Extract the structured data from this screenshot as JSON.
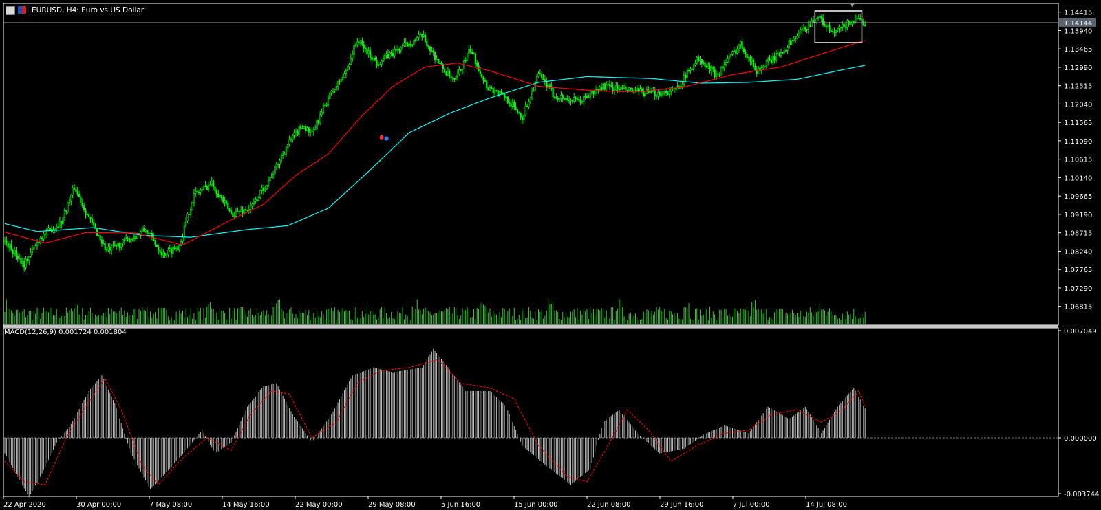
{
  "header": {
    "symbol_title": "EURUSD, H4:  Euro vs US Dollar",
    "macd_label": "MACD(12,26,9) 0.001724 0.001804"
  },
  "colors": {
    "background": "#000000",
    "axis": "#ffffff",
    "candle": "#00ff00",
    "volume": "#32cd32",
    "ma_fast": "#ff0000",
    "ma_slow": "#00ffff",
    "macd_hist": "#c0c0c0",
    "macd_signal": "#ff0000",
    "grid_line": "#a0a0a0"
  },
  "chart_data": [
    {
      "type": "candlestick",
      "title": "EURUSD, H4: Euro vs US Dollar",
      "price_ticks": [
        "1.14415",
        "1.13940",
        "1.13465",
        "1.12990",
        "1.12515",
        "1.12040",
        "1.11565",
        "1.11090",
        "1.10615",
        "1.10140",
        "1.09665",
        "1.09190",
        "1.08715",
        "1.08240",
        "1.07765",
        "1.07290",
        "1.06815"
      ],
      "current_price": "1.14144",
      "ylim": [
        1.0633,
        1.1464
      ],
      "time_labels": [
        "22 Apr 2020",
        "30 Apr 00:00",
        "7 May 08:00",
        "14 May 16:00",
        "22 May 00:00",
        "29 May 08:00",
        "5 Jun 16:00",
        "15 Jun 00:00",
        "22 Jun 08:00",
        "29 Jun 16:00",
        "7 Jul 00:00",
        "14 Jul 08:00"
      ],
      "close_keyframes": [
        [
          0,
          1.085
        ],
        [
          12,
          1.079
        ],
        [
          22,
          1.086
        ],
        [
          35,
          1.09
        ],
        [
          43,
          1.099
        ],
        [
          52,
          1.091
        ],
        [
          63,
          1.0825
        ],
        [
          75,
          1.085
        ],
        [
          87,
          1.088
        ],
        [
          98,
          1.0815
        ],
        [
          108,
          1.084
        ],
        [
          117,
          1.097
        ],
        [
          128,
          1.1
        ],
        [
          140,
          1.092
        ],
        [
          152,
          1.0935
        ],
        [
          165,
          1.102
        ],
        [
          175,
          1.11
        ],
        [
          184,
          1.115
        ],
        [
          190,
          1.1125
        ],
        [
          200,
          1.122
        ],
        [
          210,
          1.128
        ],
        [
          218,
          1.137
        ],
        [
          230,
          1.131
        ],
        [
          245,
          1.135
        ],
        [
          258,
          1.138
        ],
        [
          270,
          1.13
        ],
        [
          278,
          1.126
        ],
        [
          288,
          1.1345
        ],
        [
          298,
          1.125
        ],
        [
          310,
          1.122
        ],
        [
          320,
          1.117
        ],
        [
          330,
          1.128
        ],
        [
          340,
          1.1225
        ],
        [
          355,
          1.121
        ],
        [
          370,
          1.125
        ],
        [
          385,
          1.124
        ],
        [
          400,
          1.123
        ],
        [
          415,
          1.124
        ],
        [
          428,
          1.132
        ],
        [
          440,
          1.128
        ],
        [
          455,
          1.136
        ],
        [
          465,
          1.129
        ],
        [
          478,
          1.133
        ],
        [
          492,
          1.139
        ],
        [
          503,
          1.143
        ],
        [
          512,
          1.1385
        ],
        [
          524,
          1.142
        ],
        [
          533,
          1.1414
        ]
      ],
      "ma_fast_keyframes": [
        [
          0,
          1.0873
        ],
        [
          25,
          1.0845
        ],
        [
          50,
          1.0872
        ],
        [
          80,
          1.0871
        ],
        [
          110,
          1.084
        ],
        [
          140,
          1.0905
        ],
        [
          160,
          1.0945
        ],
        [
          180,
          1.102
        ],
        [
          200,
          1.1075
        ],
        [
          220,
          1.117
        ],
        [
          240,
          1.125
        ],
        [
          260,
          1.13
        ],
        [
          280,
          1.131
        ],
        [
          300,
          1.129
        ],
        [
          330,
          1.125
        ],
        [
          360,
          1.124
        ],
        [
          390,
          1.1235
        ],
        [
          420,
          1.1248
        ],
        [
          450,
          1.128
        ],
        [
          480,
          1.13
        ],
        [
          510,
          1.134
        ],
        [
          533,
          1.137
        ]
      ],
      "ma_slow_keyframes": [
        [
          0,
          1.0895
        ],
        [
          20,
          1.0875
        ],
        [
          55,
          1.0885
        ],
        [
          85,
          1.0865
        ],
        [
          115,
          1.086
        ],
        [
          150,
          1.088
        ],
        [
          175,
          1.089
        ],
        [
          200,
          1.0935
        ],
        [
          225,
          1.103
        ],
        [
          250,
          1.113
        ],
        [
          275,
          1.118
        ],
        [
          300,
          1.122
        ],
        [
          330,
          1.126
        ],
        [
          360,
          1.1275
        ],
        [
          400,
          1.127
        ],
        [
          430,
          1.1258
        ],
        [
          460,
          1.126
        ],
        [
          490,
          1.1268
        ],
        [
          515,
          1.129
        ],
        [
          533,
          1.1305
        ]
      ],
      "bars": 533
    },
    {
      "type": "histogram",
      "title": "MACD(12,26,9) 0.001724 0.001804",
      "y_ticks": [
        "0.007049",
        "0.000000",
        "-0.003744"
      ],
      "ylim": [
        -0.003744,
        0.007049
      ],
      "macd_keyframes": [
        [
          0,
          -0.001
        ],
        [
          15,
          -0.0038
        ],
        [
          22,
          -0.0025
        ],
        [
          32,
          -0.0003
        ],
        [
          40,
          0.0007
        ],
        [
          52,
          0.003
        ],
        [
          60,
          0.004
        ],
        [
          68,
          0.0022
        ],
        [
          78,
          -0.001
        ],
        [
          90,
          -0.0033
        ],
        [
          100,
          -0.0022
        ],
        [
          112,
          -0.0008
        ],
        [
          122,
          0.0005
        ],
        [
          130,
          -0.001
        ],
        [
          140,
          -0.0003
        ],
        [
          150,
          0.002
        ],
        [
          160,
          0.0033
        ],
        [
          168,
          0.0035
        ],
        [
          178,
          0.0015
        ],
        [
          190,
          -0.0003
        ],
        [
          202,
          0.0015
        ],
        [
          215,
          0.004
        ],
        [
          228,
          0.0045
        ],
        [
          240,
          0.0042
        ],
        [
          258,
          0.0045
        ],
        [
          265,
          0.0057
        ],
        [
          272,
          0.0048
        ],
        [
          285,
          0.003
        ],
        [
          300,
          0.003
        ],
        [
          310,
          0.002
        ],
        [
          320,
          -0.0005
        ],
        [
          335,
          -0.0018
        ],
        [
          350,
          -0.003
        ],
        [
          362,
          -0.002
        ],
        [
          370,
          0.001
        ],
        [
          380,
          0.0018
        ],
        [
          392,
          0.0002
        ],
        [
          405,
          -0.001
        ],
        [
          420,
          -0.0007
        ],
        [
          432,
          0.0002
        ],
        [
          445,
          0.0008
        ],
        [
          460,
          0.0003
        ],
        [
          472,
          0.002
        ],
        [
          485,
          0.0012
        ],
        [
          495,
          0.002
        ],
        [
          505,
          0.0003
        ],
        [
          515,
          0.002
        ],
        [
          525,
          0.0032
        ],
        [
          533,
          0.0017
        ]
      ],
      "signal_keyframes": [
        [
          0,
          -0.0015
        ],
        [
          12,
          -0.0028
        ],
        [
          25,
          -0.003
        ],
        [
          38,
          0.0
        ],
        [
          50,
          0.002
        ],
        [
          62,
          0.0038
        ],
        [
          72,
          0.0018
        ],
        [
          85,
          -0.0018
        ],
        [
          95,
          -0.003
        ],
        [
          108,
          -0.0015
        ],
        [
          125,
          0.0
        ],
        [
          140,
          -0.0008
        ],
        [
          152,
          0.0015
        ],
        [
          165,
          0.003
        ],
        [
          176,
          0.0028
        ],
        [
          190,
          0.0
        ],
        [
          205,
          0.001
        ],
        [
          218,
          0.0035
        ],
        [
          232,
          0.0043
        ],
        [
          250,
          0.0045
        ],
        [
          268,
          0.005
        ],
        [
          282,
          0.0035
        ],
        [
          300,
          0.0032
        ],
        [
          315,
          0.0025
        ],
        [
          330,
          -0.0005
        ],
        [
          348,
          -0.0025
        ],
        [
          360,
          -0.0028
        ],
        [
          373,
          -0.0005
        ],
        [
          385,
          0.0018
        ],
        [
          398,
          0.0005
        ],
        [
          412,
          -0.0015
        ],
        [
          428,
          -0.0005
        ],
        [
          445,
          0.0003
        ],
        [
          460,
          0.0005
        ],
        [
          474,
          0.0015
        ],
        [
          490,
          0.0018
        ],
        [
          505,
          0.001
        ],
        [
          518,
          0.0018
        ],
        [
          528,
          0.003
        ],
        [
          533,
          0.0018
        ]
      ]
    }
  ]
}
